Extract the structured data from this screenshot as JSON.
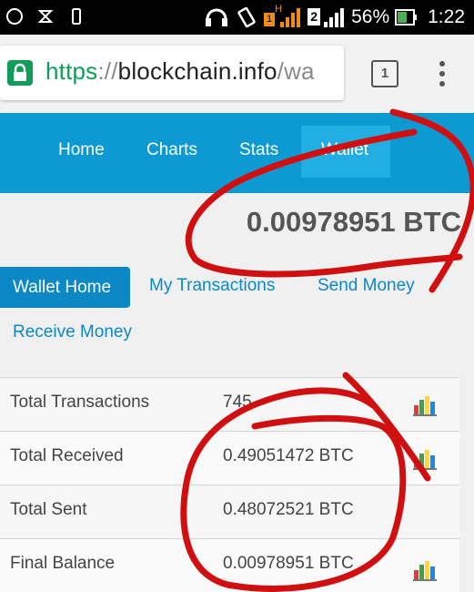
{
  "status_bar": {
    "battery_percent": "56%",
    "time": "1:22",
    "sim_badge": "2",
    "network_badge": "1",
    "network_type": "H"
  },
  "browser": {
    "url_scheme": "https",
    "url_separator": "://",
    "url_host": "blockchain.info",
    "url_path": "/wa",
    "tab_count": "1"
  },
  "nav": {
    "items": [
      "Home",
      "Charts",
      "Stats",
      "Wallet"
    ],
    "active": "Wallet"
  },
  "wallet": {
    "balance": "0.00978951 BTC",
    "menu": [
      "Wallet Home",
      "My Transactions",
      "Send Money",
      "Receive Money"
    ]
  },
  "summary": {
    "rows": [
      {
        "label": "Total Transactions",
        "value": "745"
      },
      {
        "label": "Total Received",
        "value": "0.49051472 BTC"
      },
      {
        "label": "Total Sent",
        "value": "0.48072521 BTC"
      },
      {
        "label": "Final Balance",
        "value": "0.00978951 BTC"
      }
    ]
  },
  "colors": {
    "nav_bg": "#0d99d1",
    "nav_active_bg": "#23aee3",
    "link": "#0c88c7",
    "annotation_red": "#d01010",
    "url_green": "#0f9d58"
  }
}
